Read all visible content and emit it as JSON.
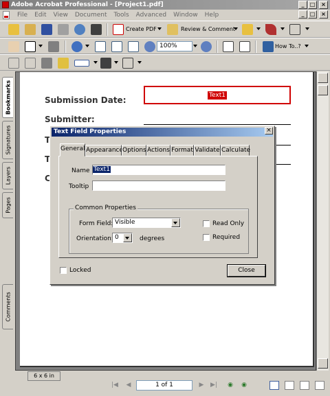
{
  "window": {
    "title": "Adobe Acrobat Professional - [Project1.pdf]"
  },
  "menu": [
    "File",
    "Edit",
    "View",
    "Document",
    "Tools",
    "Advanced",
    "Window",
    "Help"
  ],
  "toolbar": {
    "create_pdf": "Create PDF",
    "review_comment": "Review & Comment",
    "zoom": "100%",
    "how_to": "How To..?"
  },
  "side_tabs": {
    "bookmarks": "Bookmarks",
    "signatures": "Signatures",
    "layers": "Layers",
    "pages": "Pages",
    "comments": "Comments"
  },
  "form": {
    "submission_date": "Submission Date:",
    "submitter": "Submitter:",
    "field_value": "Text1",
    "partial3": "T",
    "partial4": "T",
    "partial5": "C"
  },
  "status": {
    "page_size": "6 x 6 in",
    "page_indicator": "1 of 1"
  },
  "dialog": {
    "title": "Text Field Properties",
    "tabs": [
      "General",
      "Appearance",
      "Options",
      "Actions",
      "Format",
      "Validate",
      "Calculate"
    ],
    "name_label": "Name",
    "name_value": "Text1",
    "tooltip_label": "Tooltip",
    "tooltip_value": "",
    "group_title": "Common Properties",
    "form_field_label": "Form Field:",
    "form_field_value": "Visible",
    "orientation_label": "Orientation:",
    "orientation_value": "0",
    "degrees": "degrees",
    "read_only": "Read Only",
    "required": "Required",
    "locked": "Locked",
    "close": "Close"
  }
}
